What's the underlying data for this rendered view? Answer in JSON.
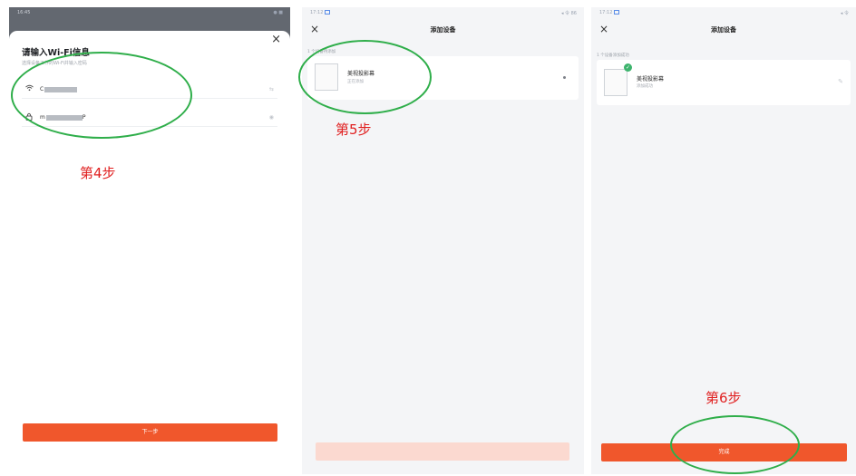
{
  "panel1": {
    "status_time": "16:45",
    "status_right": "● ■",
    "close_glyph": "×",
    "title": "请输入Wi-Fi信息",
    "subtitle": "选择设备工作的Wi-Fi并输入密码",
    "wifi_prefix": "C",
    "password_prefix": "m",
    "password_suffix": "P",
    "switch_glyph": "⇆",
    "eye_glyph": "◉",
    "next_label": "下一步",
    "step_label": "第4步"
  },
  "panel2": {
    "status_time": "17:12",
    "status_right": "◂ 令 86",
    "close_glyph": "×",
    "title": "添加设备",
    "section_label": "1 个设备待添加",
    "device_name": "美视投影幕",
    "device_status": "正在添加",
    "step_label": "第5步"
  },
  "panel3": {
    "status_time": "17:12",
    "status_right": "◂ 令",
    "close_glyph": "×",
    "title": "添加设备",
    "section_label": "1 个设备添加成功",
    "device_name": "美视投影幕",
    "device_status": "添加成功",
    "check_glyph": "✓",
    "edit_glyph": "✎",
    "done_label": "完成",
    "step_label": "第6步"
  },
  "colors": {
    "accent_orange": "#f0572c",
    "disabled_orange": "#fbd9d0",
    "annotation_green": "#2fae4a",
    "annotation_red": "#e02020",
    "success_green": "#3db46d"
  },
  "icons": [
    "wifi-icon",
    "lock-icon",
    "switch-network-icon",
    "eye-icon",
    "close-icon",
    "check-icon",
    "edit-icon"
  ]
}
